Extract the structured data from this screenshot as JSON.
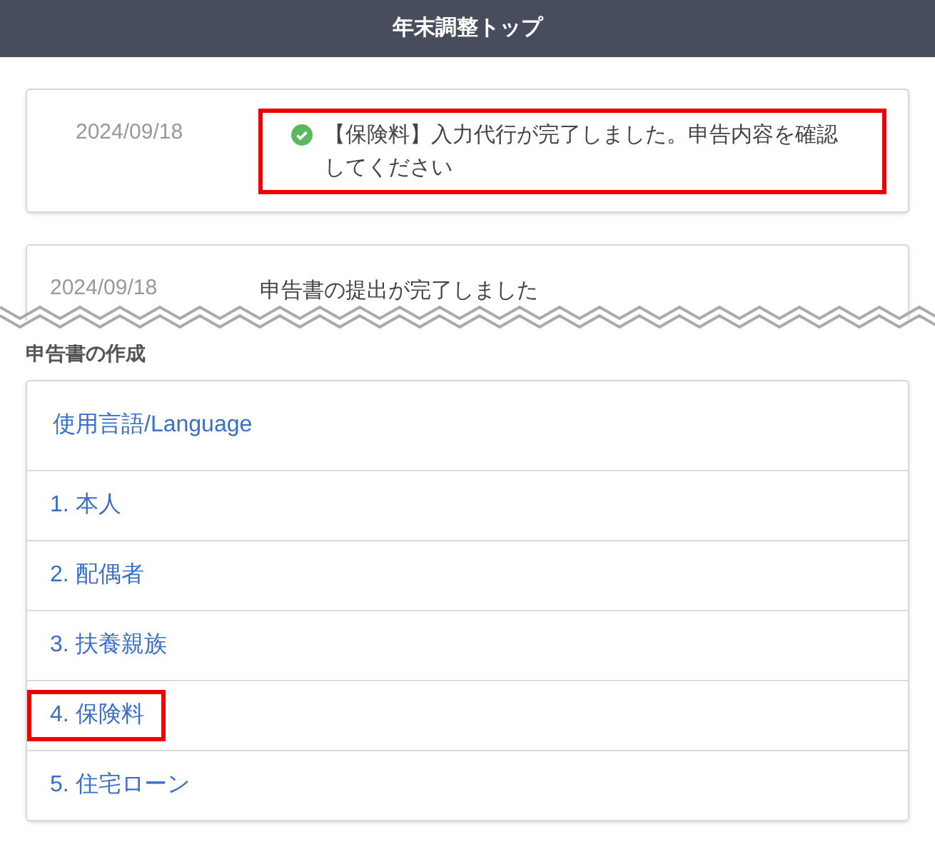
{
  "header": {
    "title": "年末調整トップ"
  },
  "notifications": [
    {
      "date": "2024/09/18",
      "message": "【保険料】入力代行が完了しました。申告内容を確認してください",
      "done": true,
      "highlighted": true
    },
    {
      "date": "2024/09/18",
      "message": "申告書の提出が完了しました",
      "done": false,
      "highlighted": false
    }
  ],
  "section": {
    "title": "申告書の作成"
  },
  "menu": [
    {
      "label": "使用言語/Language",
      "kind": "language",
      "highlighted": false
    },
    {
      "label": "1. 本人",
      "kind": "step",
      "highlighted": false
    },
    {
      "label": "2. 配偶者",
      "kind": "step",
      "highlighted": false
    },
    {
      "label": "3. 扶養親族",
      "kind": "step",
      "highlighted": false
    },
    {
      "label": "4. 保険料",
      "kind": "step",
      "highlighted": true
    },
    {
      "label": "5. 住宅ローン",
      "kind": "step",
      "highlighted": false
    }
  ]
}
